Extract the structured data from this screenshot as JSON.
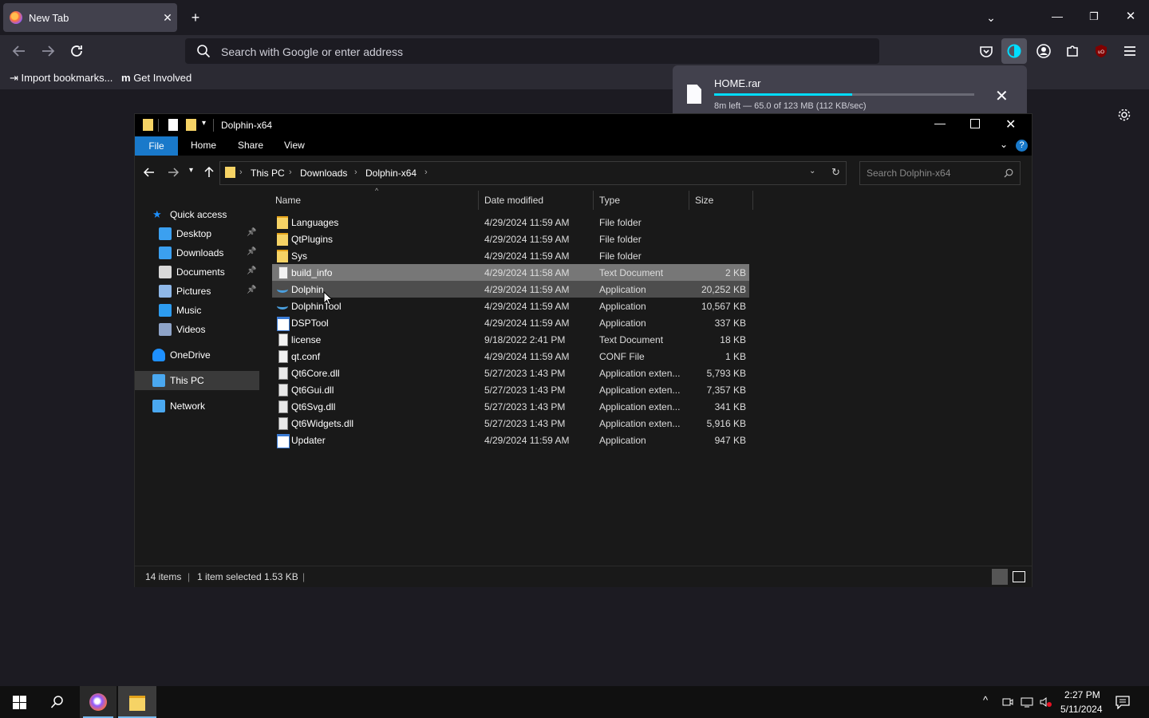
{
  "browser": {
    "tab_title": "New Tab",
    "url_placeholder": "Search with Google or enter address",
    "bookmarks": [
      "Import bookmarks...",
      "Get Involved"
    ],
    "download": {
      "file_name": "HOME.rar",
      "status": "8m left — 65.0 of 123 MB (112 KB/sec)",
      "progress": 0.53
    }
  },
  "explorer": {
    "title": "Dolphin-x64",
    "ribbon_tabs": [
      "File",
      "Home",
      "Share",
      "View"
    ],
    "breadcrumb": [
      "This PC",
      "Downloads",
      "Dolphin-x64"
    ],
    "search_placeholder": "Search Dolphin-x64",
    "nav": [
      {
        "label": "Quick access",
        "icon": "star-icon",
        "pinned": false
      },
      {
        "label": "Desktop",
        "icon": "desktop-icon",
        "pinned": true
      },
      {
        "label": "Downloads",
        "icon": "download-icon",
        "pinned": true
      },
      {
        "label": "Documents",
        "icon": "document-icon",
        "pinned": true
      },
      {
        "label": "Pictures",
        "icon": "picture-icon",
        "pinned": true
      },
      {
        "label": "Music",
        "icon": "music-icon",
        "pinned": false
      },
      {
        "label": "Videos",
        "icon": "video-icon",
        "pinned": false
      },
      {
        "label": "OneDrive",
        "icon": "cloud-icon",
        "pinned": false
      },
      {
        "label": "This PC",
        "icon": "computer-icon",
        "pinned": false
      },
      {
        "label": "Network",
        "icon": "network-icon",
        "pinned": false
      }
    ],
    "columns": [
      "Name",
      "Date modified",
      "Type",
      "Size"
    ],
    "files": [
      {
        "name": "Languages",
        "date": "4/29/2024 11:59 AM",
        "type": "File folder",
        "size": "",
        "kind": "folder"
      },
      {
        "name": "QtPlugins",
        "date": "4/29/2024 11:59 AM",
        "type": "File folder",
        "size": "",
        "kind": "folder"
      },
      {
        "name": "Sys",
        "date": "4/29/2024 11:59 AM",
        "type": "File folder",
        "size": "",
        "kind": "folder"
      },
      {
        "name": "build_info",
        "date": "4/29/2024 11:58 AM",
        "type": "Text Document",
        "size": "2 KB",
        "kind": "text"
      },
      {
        "name": "Dolphin",
        "date": "4/29/2024 11:59 AM",
        "type": "Application",
        "size": "20,252 KB",
        "kind": "dolphin"
      },
      {
        "name": "DolphinTool",
        "date": "4/29/2024 11:59 AM",
        "type": "Application",
        "size": "10,567 KB",
        "kind": "dolphin"
      },
      {
        "name": "DSPTool",
        "date": "4/29/2024 11:59 AM",
        "type": "Application",
        "size": "337 KB",
        "kind": "app"
      },
      {
        "name": "license",
        "date": "9/18/2022 2:41 PM",
        "type": "Text Document",
        "size": "18 KB",
        "kind": "text"
      },
      {
        "name": "qt.conf",
        "date": "4/29/2024 11:59 AM",
        "type": "CONF File",
        "size": "1 KB",
        "kind": "text"
      },
      {
        "name": "Qt6Core.dll",
        "date": "5/27/2023 1:43 PM",
        "type": "Application exten...",
        "size": "5,793 KB",
        "kind": "dll"
      },
      {
        "name": "Qt6Gui.dll",
        "date": "5/27/2023 1:43 PM",
        "type": "Application exten...",
        "size": "7,357 KB",
        "kind": "dll"
      },
      {
        "name": "Qt6Svg.dll",
        "date": "5/27/2023 1:43 PM",
        "type": "Application exten...",
        "size": "341 KB",
        "kind": "dll"
      },
      {
        "name": "Qt6Widgets.dll",
        "date": "5/27/2023 1:43 PM",
        "type": "Application exten...",
        "size": "5,916 KB",
        "kind": "dll"
      },
      {
        "name": "Updater",
        "date": "4/29/2024 11:59 AM",
        "type": "Application",
        "size": "947 KB",
        "kind": "app"
      }
    ],
    "status": {
      "count": "14 items",
      "selection": "1 item selected  1.53 KB"
    }
  },
  "taskbar": {
    "time": "2:27 PM",
    "date": "5/11/2024"
  },
  "colors": {
    "accent": "#1979ca",
    "firefox_accent": "#00ddff"
  }
}
